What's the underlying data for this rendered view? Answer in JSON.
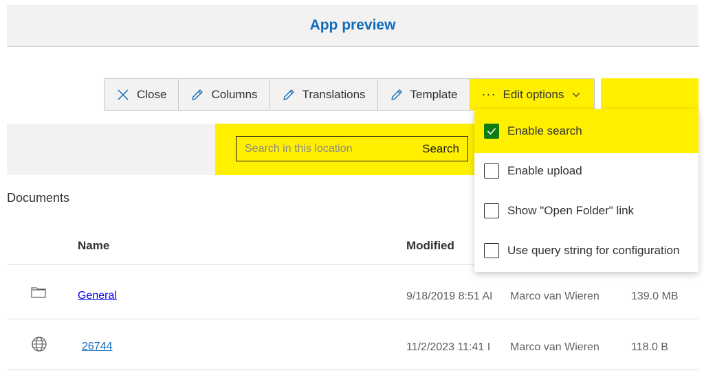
{
  "header": {
    "title": "App preview"
  },
  "toolbar": {
    "close": "Close",
    "columns": "Columns",
    "translations": "Translations",
    "template": "Template",
    "edit_options": "Edit options"
  },
  "search": {
    "placeholder": "Search in this location",
    "button": "Search"
  },
  "documents": {
    "title": "Documents",
    "columns": {
      "name": "Name",
      "modified": "Modified"
    },
    "rows": [
      {
        "icon": "folder-icon",
        "name": "General",
        "modified": "9/18/2019 8:51 AI",
        "modified_by": "Marco van Wieren",
        "size": "139.0 MB"
      },
      {
        "icon": "globe-icon",
        "name": "26744",
        "modified": "11/2/2023 11:41 I",
        "modified_by": "Marco van Wieren",
        "size": "118.0 B"
      }
    ]
  },
  "edit_menu": {
    "items": [
      {
        "label": "Enable search",
        "checked": true
      },
      {
        "label": "Enable upload",
        "checked": false
      },
      {
        "label": "Show \"Open Folder\" link",
        "checked": false
      },
      {
        "label": "Use query string for configuration",
        "checked": false
      }
    ]
  },
  "colors": {
    "accent": "#0f6cbd",
    "highlight": "#fff000",
    "check": "#107c10"
  }
}
